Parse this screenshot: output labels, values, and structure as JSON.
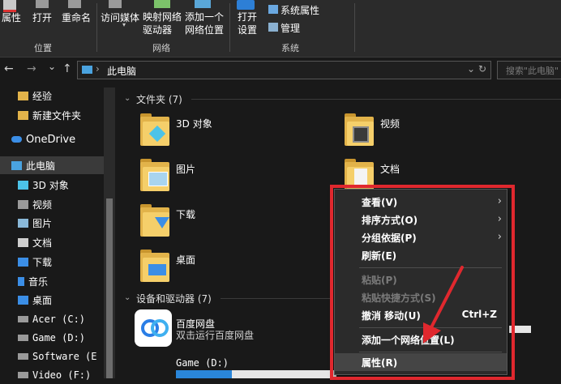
{
  "ribbon": {
    "buttons": [
      {
        "label": "属性"
      },
      {
        "label": "打开"
      },
      {
        "label": "重命名"
      },
      {
        "label": "访问媒体"
      },
      {
        "label": "映射网络\n驱动器"
      },
      {
        "label": "添加一个\n网络位置"
      },
      {
        "label": "打开\n设置"
      }
    ],
    "small_buttons": [
      {
        "label": "系统属性"
      },
      {
        "label": "管理"
      }
    ],
    "groups": [
      "位置",
      "网络",
      "系统"
    ]
  },
  "address": {
    "back": "←",
    "forward": "→",
    "recent": "⌄",
    "up": "↑",
    "path": "此电脑",
    "search_placeholder": "搜索\"此电脑\""
  },
  "sidebar": {
    "items": [
      {
        "label": "经验",
        "color": "#e2b34a"
      },
      {
        "label": "新建文件夹",
        "color": "#e2b34a"
      },
      {
        "label": "OneDrive",
        "color": "#3b8ee6"
      },
      {
        "label": "此电脑",
        "color": "#4aa3e0"
      },
      {
        "label": "3D 对象",
        "color": "#4cc3e8"
      },
      {
        "label": "视频",
        "color": "#9a9a9a"
      },
      {
        "label": "图片",
        "color": "#8ab8d8"
      },
      {
        "label": "文档",
        "color": "#cfcfcf"
      },
      {
        "label": "下载",
        "color": "#3b8ee6"
      },
      {
        "label": "音乐",
        "color": "#3b8ee6"
      },
      {
        "label": "桌面",
        "color": "#3b8ee6"
      },
      {
        "label": "Acer (C:)",
        "color": "#9a9a9a"
      },
      {
        "label": "Game (D:)",
        "color": "#9a9a9a"
      },
      {
        "label": "Software (E",
        "color": "#9a9a9a"
      },
      {
        "label": "Video (F:)",
        "color": "#9a9a9a"
      }
    ]
  },
  "main": {
    "folders_header": "文件夹 (7)",
    "folders": [
      {
        "label": "3D 对象"
      },
      {
        "label": "视频"
      },
      {
        "label": "图片"
      },
      {
        "label": "文档"
      },
      {
        "label": "下载"
      },
      {
        "label": "桌面"
      }
    ],
    "devices_header": "设备和驱动器 (7)",
    "baidu": {
      "name": "百度网盘",
      "desc": "双击运行百度网盘"
    },
    "drive": {
      "label": "Game (D:)",
      "used_fraction": 0.35
    }
  },
  "context_menu": {
    "items": [
      {
        "label": "查看(V)",
        "shortcut": "",
        "submenu": "›",
        "disabled": false
      },
      {
        "label": "排序方式(O)",
        "shortcut": "",
        "submenu": "›",
        "disabled": false
      },
      {
        "label": "分组依据(P)",
        "shortcut": "",
        "submenu": "›",
        "disabled": false
      },
      {
        "label": "刷新(E)",
        "shortcut": "",
        "submenu": "",
        "disabled": false
      },
      {
        "label": "粘贴(P)",
        "shortcut": "",
        "submenu": "",
        "disabled": true
      },
      {
        "label": "粘贴快捷方式(S)",
        "shortcut": "",
        "submenu": "",
        "disabled": true
      },
      {
        "label": "撤消 移动(U)",
        "shortcut": "Ctrl+Z",
        "submenu": "",
        "disabled": false
      },
      {
        "label": "添加一个网络位置(L)",
        "shortcut": "",
        "submenu": "",
        "disabled": false
      },
      {
        "label": "属性(R)",
        "shortcut": "",
        "submenu": "",
        "disabled": false
      }
    ],
    "highlight_color": "#e0282e"
  }
}
